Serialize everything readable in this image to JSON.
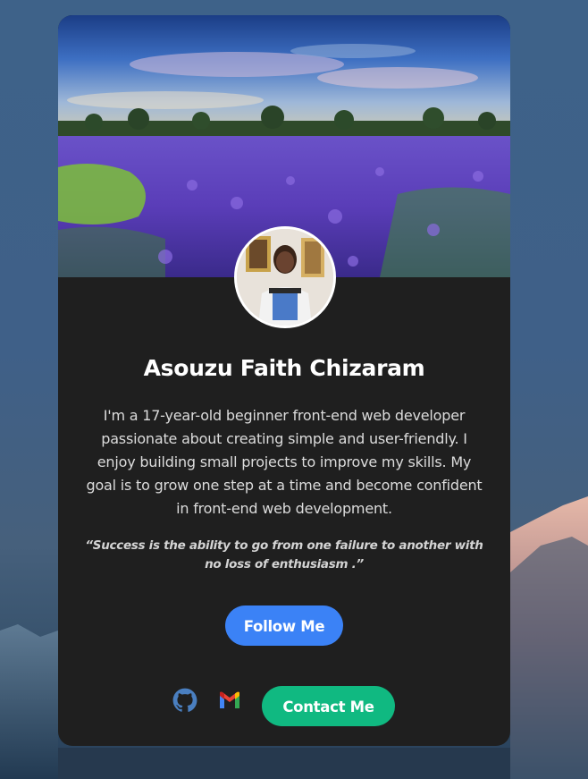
{
  "profile": {
    "name": "Asouzu Faith Chizaram",
    "bio": "I'm a 17-year-old beginner front-end web developer passionate about creating simple and user-friendly. I enjoy building small projects to improve my skills. My goal is to grow one step at a time and become confident in front-end web development.",
    "quote": "“Success is the ability to go from one failure to another with no loss of enthusiasm .”"
  },
  "actions": {
    "follow_label": "Follow Me",
    "contact_label": "Contact Me"
  },
  "icons": {
    "github": "github-icon",
    "gmail": "gmail-icon"
  },
  "colors": {
    "card_bg": "#1f1f1f",
    "follow_button": "#3b82f6",
    "contact_button": "#10b981",
    "page_bg": "#3e6289"
  }
}
